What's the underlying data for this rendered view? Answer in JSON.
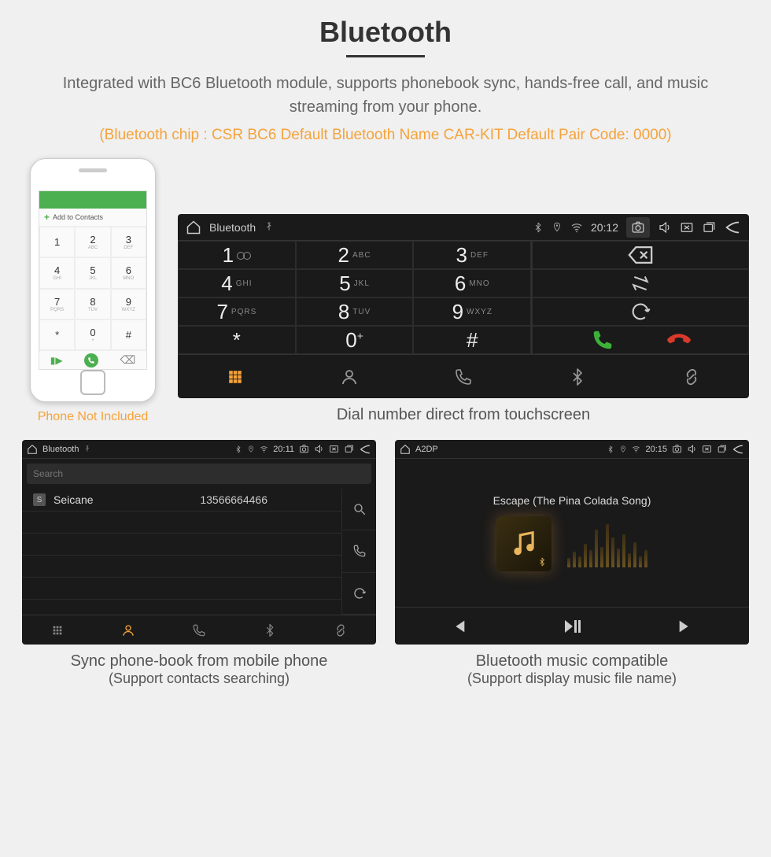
{
  "header": {
    "title": "Bluetooth",
    "subtitle": "Integrated with BC6 Bluetooth module, supports phonebook sync, hands-free call, and music streaming from your phone.",
    "specs": "(Bluetooth chip : CSR BC6     Default Bluetooth Name CAR-KIT     Default Pair Code: 0000)"
  },
  "phone": {
    "add_contacts": "Add to Contacts",
    "caption": "Phone Not Included",
    "keys": [
      {
        "d": "1",
        "l": ""
      },
      {
        "d": "2",
        "l": "ABC"
      },
      {
        "d": "3",
        "l": "DEF"
      },
      {
        "d": "4",
        "l": "GHI"
      },
      {
        "d": "5",
        "l": "JKL"
      },
      {
        "d": "6",
        "l": "MNO"
      },
      {
        "d": "7",
        "l": "PQRS"
      },
      {
        "d": "8",
        "l": "TUV"
      },
      {
        "d": "9",
        "l": "WXYZ"
      },
      {
        "d": "*",
        "l": ""
      },
      {
        "d": "0",
        "l": "+"
      },
      {
        "d": "#",
        "l": ""
      }
    ]
  },
  "dialer": {
    "status": {
      "title": "Bluetooth",
      "time": "20:12"
    },
    "keys": [
      {
        "d": "1"
      },
      {
        "d": "2",
        "l": "ABC"
      },
      {
        "d": "3",
        "l": "DEF"
      },
      {
        "d": "4",
        "l": "GHI"
      },
      {
        "d": "5",
        "l": "JKL"
      },
      {
        "d": "6",
        "l": "MNO"
      },
      {
        "d": "7",
        "l": "PQRS"
      },
      {
        "d": "8",
        "l": "TUV"
      },
      {
        "d": "9",
        "l": "WXYZ"
      },
      {
        "d": "*"
      },
      {
        "d": "0",
        "sup": "+"
      },
      {
        "d": "#"
      }
    ],
    "caption": "Dial number direct from touchscreen"
  },
  "contacts": {
    "status": {
      "title": "Bluetooth",
      "time": "20:11"
    },
    "search_placeholder": "Search",
    "rows": [
      {
        "badge": "S",
        "name": "Seicane",
        "number": "13566664466"
      }
    ],
    "caption_l1": "Sync phone-book from mobile phone",
    "caption_l2": "(Support contacts searching)"
  },
  "music": {
    "status": {
      "title": "A2DP",
      "time": "20:15"
    },
    "track": "Escape (The Pina Colada Song)",
    "eq_heights": [
      12,
      20,
      14,
      30,
      22,
      48,
      26,
      55,
      38,
      24,
      42,
      18,
      32,
      14,
      22
    ],
    "caption_l1": "Bluetooth music compatible",
    "caption_l2": "(Support display music file name)"
  }
}
